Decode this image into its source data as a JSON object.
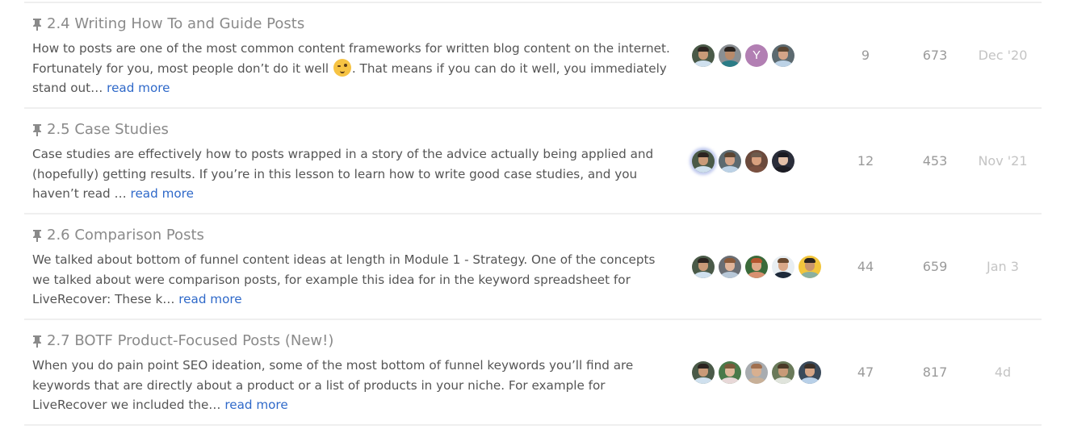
{
  "topics": [
    {
      "title": "2.4 Writing How To and Guide Posts",
      "pinned": true,
      "excerpt_before_emoji": "How to posts are one of the most common content frameworks for written blog content on the internet. Fortunately for you, most people don’t do it well ",
      "emoji": "wink-tongue-emoji",
      "excerpt_after_emoji": ". That means if you can do it well, you immediately stand out… ",
      "read_more": "read more",
      "posters": [
        {
          "type": "photo",
          "skin": "#c99a78",
          "hair": "#2b2420",
          "bg": "#4a5a48",
          "shirt": "#cfe0ee"
        },
        {
          "type": "photo",
          "skin": "#b88a6a",
          "hair": "#2a2420",
          "bg": "#8a8f93",
          "shirt": "#2b7c86"
        },
        {
          "type": "letter",
          "letter": "Y",
          "bg": "#b27fb3"
        },
        {
          "type": "photo",
          "skin": "#d4a488",
          "hair": "#5a4532",
          "bg": "#5c6a70",
          "shirt": "#bcd2e6"
        }
      ],
      "replies": "9",
      "views": "673",
      "activity": "Dec '20"
    },
    {
      "title": "2.5 Case Studies",
      "pinned": true,
      "excerpt": "Case studies are effectively how to posts wrapped in a story of the advice actually being applied and (hopefully) getting results. If you’re in this lesson to learn how to write good case studies, and you haven’t read … ",
      "read_more": "read more",
      "posters": [
        {
          "type": "photo",
          "skin": "#c99a78",
          "hair": "#2b2420",
          "bg": "#4a5a48",
          "shirt": "#cfe0ee",
          "op": true
        },
        {
          "type": "photo",
          "skin": "#d4a488",
          "hair": "#5a4532",
          "bg": "#5c6a70",
          "shirt": "#bcd2e6"
        },
        {
          "type": "photo",
          "skin": "#d8a07e",
          "hair": "#6d5a4c",
          "bg": "#6b4a3c",
          "shirt": "#7a5040"
        },
        {
          "type": "photo",
          "skin": "#e2bfa8",
          "hair": "#1a1a22",
          "bg": "#2a2d3a",
          "shirt": "#1c1c24"
        }
      ],
      "replies": "12",
      "views": "453",
      "activity": "Nov '21"
    },
    {
      "title": "2.6 Comparison Posts",
      "pinned": true,
      "excerpt": "We talked about bottom of funnel content ideas at length in Module 1 - Strategy. One of the concepts we talked about were comparison posts, for example this idea for in the keyword spreadsheet for LiveRecover: These k… ",
      "read_more": "read more",
      "posters": [
        {
          "type": "photo",
          "skin": "#c99a78",
          "hair": "#2b2420",
          "bg": "#4a5a48",
          "shirt": "#cfe0ee"
        },
        {
          "type": "photo",
          "skin": "#e2b59a",
          "hair": "#8a5a3a",
          "bg": "#6a6e74",
          "shirt": "#b8c8d8"
        },
        {
          "type": "photo",
          "skin": "#e0a888",
          "hair": "#b4552e",
          "bg": "#3a6a3a",
          "shirt": "#d89070"
        },
        {
          "type": "photo",
          "skin": "#d9a888",
          "hair": "#6a4a30",
          "bg": "#e8eef2",
          "shirt": "#1e2a3a"
        },
        {
          "type": "photo",
          "skin": "#c8956e",
          "hair": "#2a2420",
          "bg": "#f2c53c",
          "shirt": "#8ab0a0"
        }
      ],
      "replies": "44",
      "views": "659",
      "activity": "Jan 3"
    },
    {
      "title": "2.7 BOTF Product-Focused Posts (New!)",
      "pinned": true,
      "excerpt": "When you do pain point SEO ideation, some of the most bottom of funnel keywords you’ll find are keywords that are directly about a product or a list of products in your niche. For example for LiveRecover we included the… ",
      "read_more": "read more",
      "posters": [
        {
          "type": "photo",
          "skin": "#c99a78",
          "hair": "#2b2420",
          "bg": "#4a5a48",
          "shirt": "#cfe0ee"
        },
        {
          "type": "photo",
          "skin": "#e0b89a",
          "hair": "#7a5a3a",
          "bg": "#4a7a4a",
          "shirt": "#e8d8d8"
        },
        {
          "type": "photo",
          "skin": "#d8b090",
          "hair": "#a07050",
          "bg": "#a8acb0",
          "shirt": "#c8b098"
        },
        {
          "type": "photo",
          "skin": "#c89a78",
          "hair": "#4a3a28",
          "bg": "#6a7a5a",
          "shirt": "#e0e4dc"
        },
        {
          "type": "photo",
          "skin": "#d6a686",
          "hair": "#3a3028",
          "bg": "#3a4a5a",
          "shirt": "#b8d0e8"
        }
      ],
      "replies": "47",
      "views": "817",
      "activity": "4d"
    }
  ]
}
